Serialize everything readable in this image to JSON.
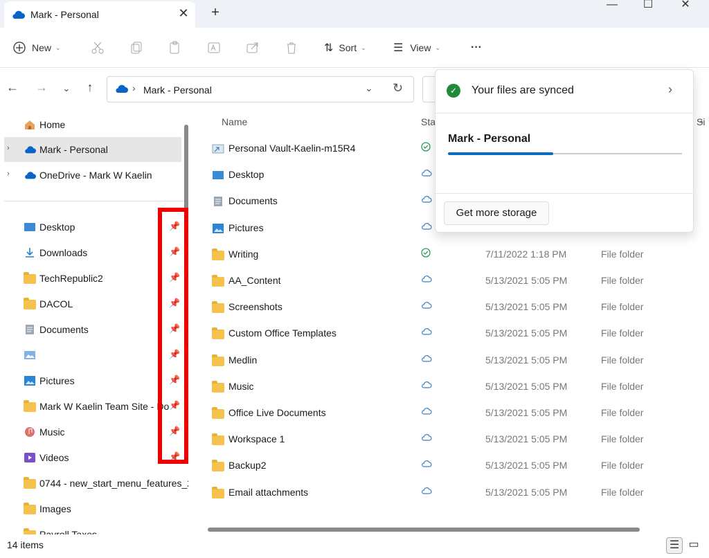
{
  "window": {
    "tab_title": "Mark - Personal",
    "new_tab": "+",
    "close_tab": "✕",
    "minimize": "—",
    "maximize": "☐",
    "close": "✕"
  },
  "toolbar": {
    "new_label": "New",
    "sort_label": "Sort",
    "view_label": "View",
    "more_label": "···"
  },
  "address": {
    "path": "Mark - Personal"
  },
  "sidebar": {
    "top_items": [
      {
        "label": "Home",
        "icon": "home-icon"
      },
      {
        "label": "Mark - Personal",
        "icon": "onedrive-icon",
        "selected": true
      },
      {
        "label": "OneDrive - Mark W Kaelin",
        "icon": "onedrive-icon"
      }
    ],
    "quick_access": [
      {
        "label": "Desktop",
        "icon": "desktop-icon"
      },
      {
        "label": "Downloads",
        "icon": "downloads-icon"
      },
      {
        "label": "TechRepublic2",
        "icon": "folder-icon"
      },
      {
        "label": "DACOL",
        "icon": "folder-icon"
      },
      {
        "label": "Documents",
        "icon": "documents-icon"
      },
      {
        "label": "",
        "icon": "image-icon"
      },
      {
        "label": "Pictures",
        "icon": "pictures-icon"
      },
      {
        "label": "Mark W Kaelin Team Site - Do",
        "icon": "folder-icon"
      },
      {
        "label": "Music",
        "icon": "music-icon"
      },
      {
        "label": "Videos",
        "icon": "videos-icon"
      },
      {
        "label": "0744 - new_start_menu_features_2",
        "icon": "folder-icon"
      },
      {
        "label": "Images",
        "icon": "folder-icon"
      },
      {
        "label": "Payroll Taxes",
        "icon": "folder-icon"
      }
    ]
  },
  "columns": {
    "name": "Name",
    "status": "Sta",
    "size": "Si"
  },
  "files": [
    {
      "name": "Personal Vault-Kaelin-m15R4",
      "icon": "vault-shortcut-icon",
      "status": "synced",
      "date": "",
      "type": ""
    },
    {
      "name": "Desktop",
      "icon": "desktop-icon",
      "status": "cloud",
      "date": "",
      "type": ""
    },
    {
      "name": "Documents",
      "icon": "documents-icon",
      "status": "cloud",
      "date": "",
      "type": ""
    },
    {
      "name": "Pictures",
      "icon": "pictures-icon",
      "status": "cloud",
      "date": "",
      "type": ""
    },
    {
      "name": "Writing",
      "icon": "folder-icon",
      "status": "synced",
      "date": "7/11/2022 1:18 PM",
      "type": "File folder"
    },
    {
      "name": "AA_Content",
      "icon": "folder-icon",
      "status": "cloud",
      "date": "5/13/2021 5:05 PM",
      "type": "File folder"
    },
    {
      "name": "Screenshots",
      "icon": "folder-icon",
      "status": "cloud",
      "date": "5/13/2021 5:05 PM",
      "type": "File folder"
    },
    {
      "name": "Custom Office Templates",
      "icon": "folder-icon",
      "status": "cloud",
      "date": "5/13/2021 5:05 PM",
      "type": "File folder"
    },
    {
      "name": "Medlin",
      "icon": "folder-icon",
      "status": "cloud",
      "date": "5/13/2021 5:05 PM",
      "type": "File folder"
    },
    {
      "name": "Music",
      "icon": "folder-icon",
      "status": "cloud",
      "date": "5/13/2021 5:05 PM",
      "type": "File folder"
    },
    {
      "name": "Office Live Documents",
      "icon": "folder-icon",
      "status": "cloud",
      "date": "5/13/2021 5:05 PM",
      "type": "File folder"
    },
    {
      "name": "Workspace 1",
      "icon": "folder-icon",
      "status": "cloud",
      "date": "5/13/2021 5:05 PM",
      "type": "File folder"
    },
    {
      "name": "Backup2",
      "icon": "folder-icon",
      "status": "cloud",
      "date": "5/13/2021 5:05 PM",
      "type": "File folder"
    },
    {
      "name": "Email attachments",
      "icon": "folder-icon",
      "status": "cloud",
      "date": "5/13/2021 5:05 PM",
      "type": "File folder"
    }
  ],
  "flyout": {
    "sync_status": "Your files are synced",
    "account": "Mark - Personal",
    "storage_used_fraction": 0.45,
    "more_storage": "Get more storage"
  },
  "statusbar": {
    "item_count": "14 items"
  },
  "colors": {
    "accent": "#0a6cc1",
    "highlight_box": "#ee0000",
    "synced_green": "#1f8a3a",
    "folder_yellow": "#f4c24d"
  }
}
